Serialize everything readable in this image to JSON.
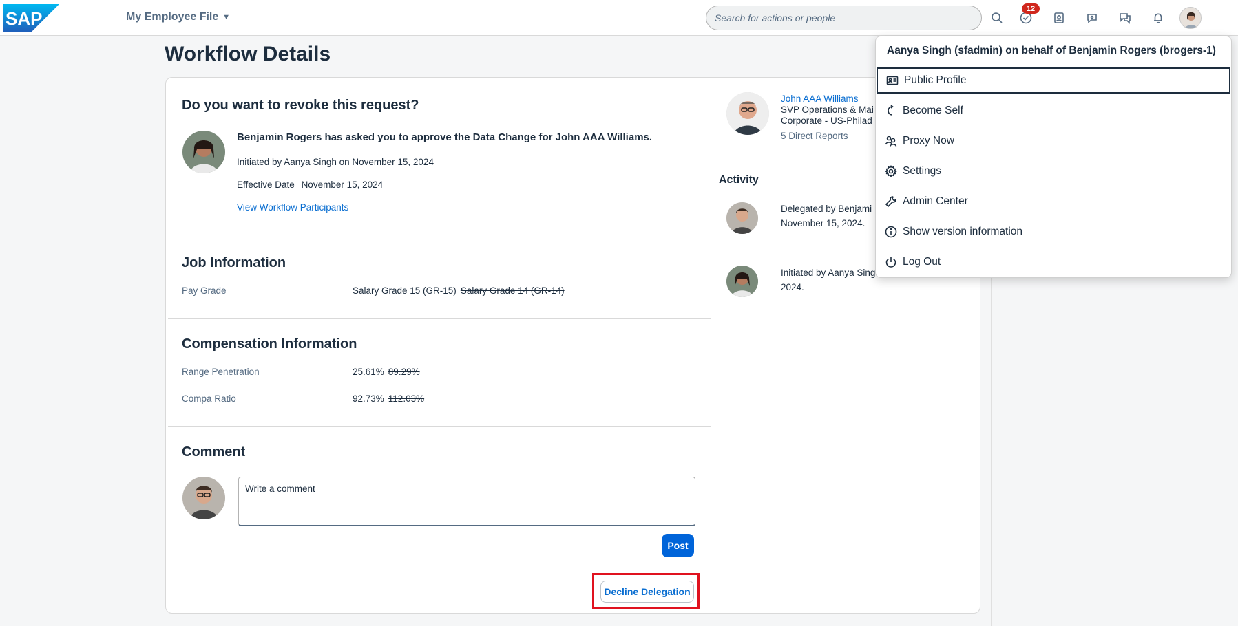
{
  "brand": {
    "logo_text": "SAP"
  },
  "shell": {
    "app_title": "My Employee File",
    "search_placeholder": "Search for actions or people",
    "tasks_badge": "12",
    "icons": [
      "search-icon",
      "tasks-icon",
      "contacts-icon",
      "chat-icon",
      "feedback-icon",
      "notification-icon",
      "user-avatar"
    ]
  },
  "page": {
    "title": "Workflow Details"
  },
  "request": {
    "heading": "Do you want to revoke this request?",
    "message": "Benjamin Rogers has asked you to approve the Data Change for John AAA Williams.",
    "initiated": "Initiated by Aanya Singh on November 15, 2024",
    "effective_label": "Effective Date",
    "effective_value": "November 15, 2024",
    "participants_link": "View Workflow Participants"
  },
  "job": {
    "heading": "Job Information",
    "fields": [
      {
        "label": "Pay Grade",
        "new": "Salary Grade 15 (GR-15)",
        "old": "Salary Grade 14 (GR-14)"
      }
    ]
  },
  "compensation": {
    "heading": "Compensation Information",
    "fields": [
      {
        "label": "Range Penetration",
        "new": "25.61%",
        "old": "89.29%"
      },
      {
        "label": "Compa Ratio",
        "new": "92.73%",
        "old": "112.03%"
      }
    ]
  },
  "comment": {
    "heading": "Comment",
    "placeholder": "Write a comment",
    "post_label": "Post"
  },
  "actions": {
    "decline_label": "Decline Delegation"
  },
  "subject": {
    "name": "John AAA Williams",
    "title": "SVP Operations & Mai",
    "location": "Corporate - US-Philad",
    "reports": "5 Direct Reports"
  },
  "activity": {
    "heading": "Activity",
    "items": [
      {
        "line1": "Delegated by Benjami",
        "line2": "November 15, 2024."
      },
      {
        "line1": "Initiated by Aanya Sing",
        "line2": "2024."
      }
    ]
  },
  "user_menu": {
    "header": "Aanya Singh (sfadmin) on behalf of Benjamin Rogers (brogers-1)",
    "items": [
      {
        "label": "Public Profile",
        "icon": "profile-card-icon"
      },
      {
        "label": "Become Self",
        "icon": "undo-icon"
      },
      {
        "label": "Proxy Now",
        "icon": "proxy-icon"
      },
      {
        "label": "Settings",
        "icon": "gear-icon"
      },
      {
        "label": "Admin Center",
        "icon": "wrench-icon"
      },
      {
        "label": "Show version information",
        "icon": "info-icon"
      },
      {
        "label": "Log Out",
        "icon": "power-icon"
      }
    ]
  },
  "colors": {
    "brand_blue": "#0a6ed1",
    "primary_button": "#0064d9",
    "badge_red": "#d0271d",
    "highlight_red": "#e0121f"
  }
}
